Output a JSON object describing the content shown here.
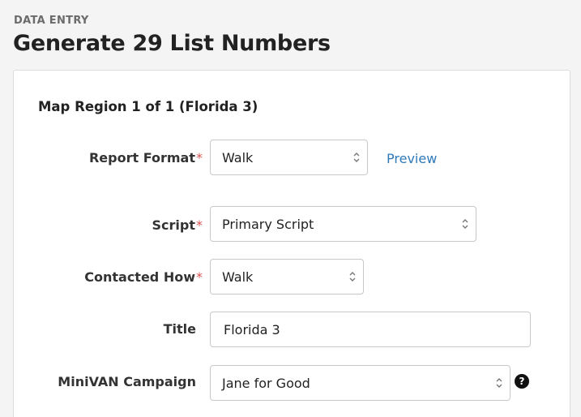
{
  "header": {
    "eyebrow": "DATA ENTRY",
    "title": "Generate 29 List Numbers"
  },
  "form": {
    "section_title": "Map Region 1 of 1 (Florida 3)",
    "report_format": {
      "label": "Report Format",
      "required_mark": "*",
      "value": "Walk",
      "preview_label": "Preview"
    },
    "script": {
      "label": "Script",
      "required_mark": "*",
      "value": "Primary Script"
    },
    "contacted_how": {
      "label": "Contacted How",
      "required_mark": "*",
      "value": "Walk"
    },
    "title": {
      "label": "Title",
      "value": "Florida 3"
    },
    "minivan_campaign": {
      "label": "MiniVAN Campaign",
      "value": "Jane for Good",
      "help_glyph": "?"
    }
  },
  "icons": {
    "select_chevron": "chevron-up-down-icon",
    "help": "question-circle-icon"
  },
  "colors": {
    "required": "#d9534f",
    "link": "#2f79b9",
    "eyebrow": "#6b6b6b"
  }
}
